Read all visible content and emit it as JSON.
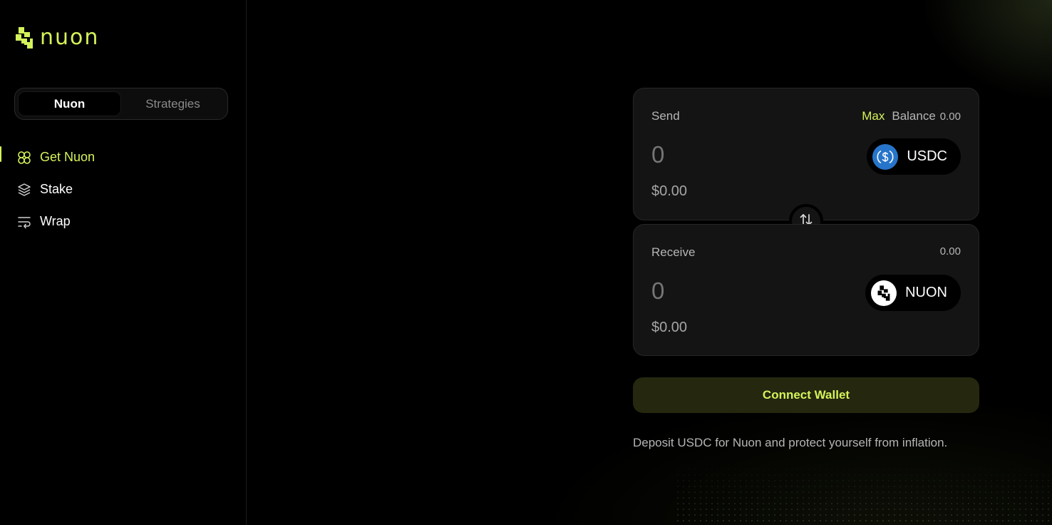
{
  "brand": {
    "name": "nuon",
    "accent": "#d4f35a"
  },
  "segment": {
    "tabs": [
      {
        "label": "Nuon",
        "active": true
      },
      {
        "label": "Strategies",
        "active": false
      }
    ]
  },
  "nav": {
    "items": [
      {
        "label": "Get Nuon",
        "icon": "get-nuon-icon",
        "active": true
      },
      {
        "label": "Stake",
        "icon": "layers-icon",
        "active": false
      },
      {
        "label": "Wrap",
        "icon": "wrap-icon",
        "active": false
      }
    ]
  },
  "send": {
    "label": "Send",
    "max_label": "Max",
    "balance_label": "Balance",
    "balance_value": "0.00",
    "amount_placeholder": "0",
    "usd_value": "$0.00",
    "token": "USDC",
    "token_icon": "usdc-icon"
  },
  "receive": {
    "label": "Receive",
    "balance_value": "0.00",
    "amount_placeholder": "0",
    "usd_value": "$0.00",
    "token": "NUON",
    "token_icon": "nuon-token-icon"
  },
  "swap_icon": "swap-arrows-icon",
  "connect_button": "Connect Wallet",
  "note": "Deposit USDC for Nuon and protect yourself from inflation.",
  "colors": {
    "background": "#000000",
    "card": "#141414",
    "button_bg": "#25270f",
    "usdc": "#2775ca"
  }
}
